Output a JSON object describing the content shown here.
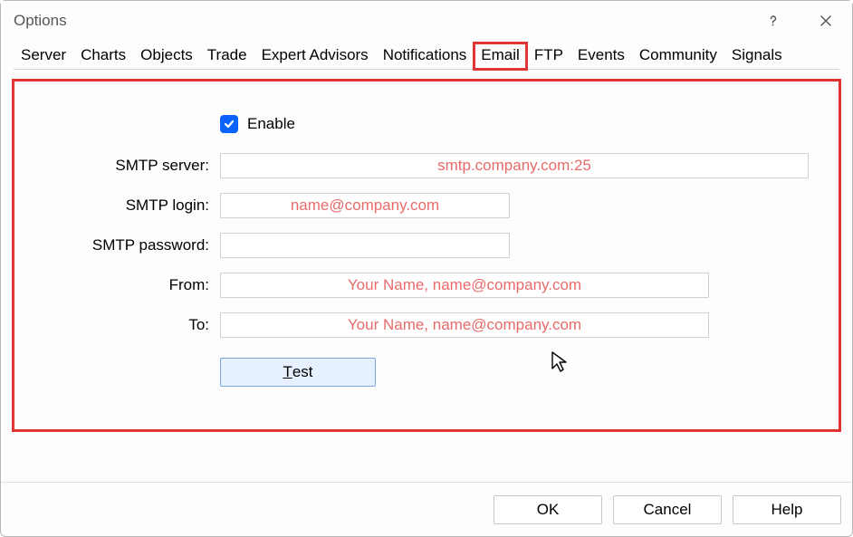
{
  "window": {
    "title": "Options"
  },
  "tabs": [
    {
      "label": "Server",
      "selected": false
    },
    {
      "label": "Charts",
      "selected": false
    },
    {
      "label": "Objects",
      "selected": false
    },
    {
      "label": "Trade",
      "selected": false
    },
    {
      "label": "Expert Advisors",
      "selected": false
    },
    {
      "label": "Notifications",
      "selected": false
    },
    {
      "label": "Email",
      "selected": true
    },
    {
      "label": "FTP",
      "selected": false
    },
    {
      "label": "Events",
      "selected": false
    },
    {
      "label": "Community",
      "selected": false
    },
    {
      "label": "Signals",
      "selected": false
    }
  ],
  "form": {
    "enable": {
      "label": "Enable",
      "checked": true
    },
    "smtp_server": {
      "label": "SMTP server:",
      "placeholder": "smtp.company.com:25",
      "value": ""
    },
    "smtp_login": {
      "label": "SMTP login:",
      "placeholder": "name@company.com",
      "value": ""
    },
    "smtp_password": {
      "label": "SMTP password:",
      "placeholder": "",
      "value": ""
    },
    "from": {
      "label": "From:",
      "placeholder": "Your Name, name@company.com",
      "value": ""
    },
    "to": {
      "label": "To:",
      "placeholder": "Your Name, name@company.com",
      "value": ""
    },
    "test_button": "Test",
    "test_underline_char": "T"
  },
  "buttons": {
    "ok": "OK",
    "cancel": "Cancel",
    "help": "Help"
  },
  "annotation": {
    "highlight_tab_index": 6,
    "red_frame_visible": true,
    "cursor_visible": true
  }
}
